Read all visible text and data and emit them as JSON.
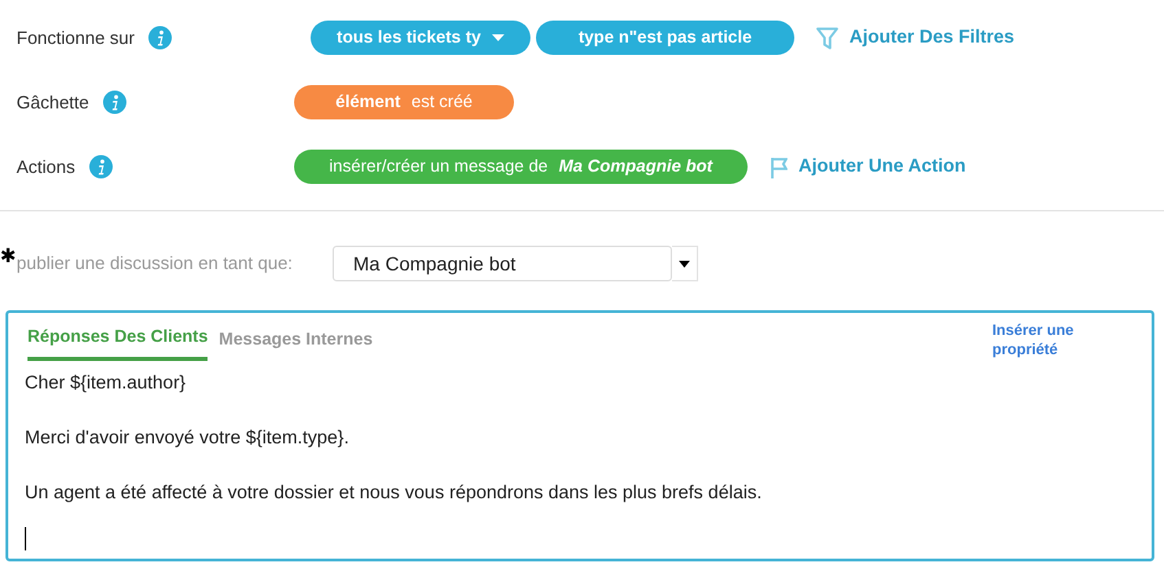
{
  "rules": [
    {
      "label": "Fonctionne sur",
      "pills": [
        {
          "color": "#29afd9",
          "dropdown": true,
          "segments": [
            {
              "text": "tous les tickets ty",
              "kind": "bold"
            }
          ]
        },
        {
          "color": "#29afd9",
          "dropdown": false,
          "segments": [
            {
              "text": "type n\"est pas article",
              "kind": "bold"
            }
          ]
        }
      ],
      "add": {
        "kind": "filter",
        "text": "Ajouter Des Filtres"
      }
    },
    {
      "label": "Gâchette",
      "pills": [
        {
          "color": "#f78a43",
          "dropdown": false,
          "segments": [
            {
              "text": "élément",
              "kind": "bold"
            },
            {
              "text": "est créé",
              "kind": "normal"
            }
          ]
        }
      ]
    },
    {
      "label": "Actions",
      "pills": [
        {
          "color": "#45b649",
          "dropdown": false,
          "segments": [
            {
              "text": "insérer/créer un message de",
              "kind": "normal"
            },
            {
              "text": "Ma Compagnie bot",
              "kind": "emphasis"
            }
          ]
        }
      ],
      "add": {
        "kind": "flag",
        "text": "Ajouter Une Action"
      }
    }
  ],
  "publish": {
    "required_mark": "✱",
    "label": "publier une discussion en tant que:",
    "value": "Ma Compagnie bot"
  },
  "editor": {
    "tabs": [
      {
        "label": "Réponses Des Clients",
        "selected": true
      },
      {
        "label": "Messages Internes",
        "selected": false
      }
    ],
    "insert_link": "Insérer une propriété",
    "lines": [
      "Cher ${item.author}",
      "Merci d'avoir envoyé votre ${item.type}.",
      "Un agent a été affecté à votre dossier et nous vous répondrons dans les plus brefs délais."
    ],
    "cursor": true
  }
}
